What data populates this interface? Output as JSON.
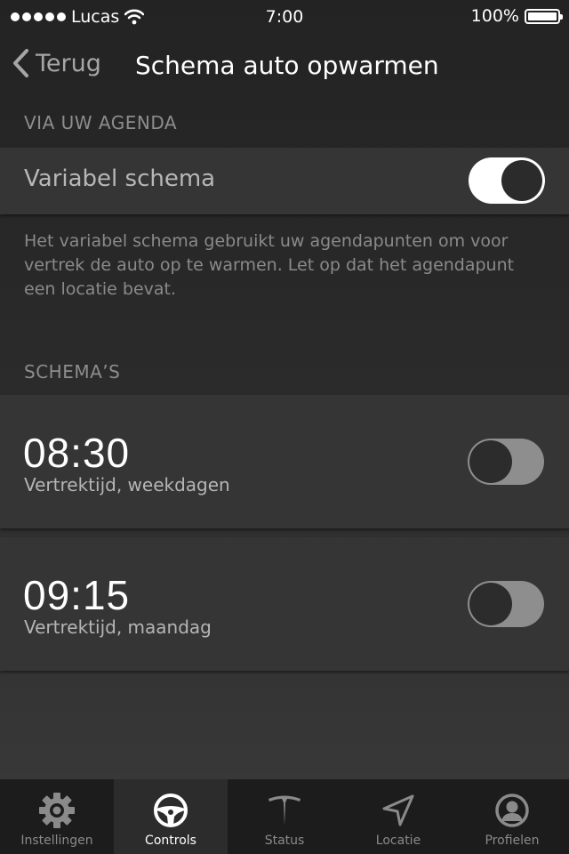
{
  "status_bar": {
    "carrier": "Lucas",
    "signal_icon": "signal-dots-icon",
    "wifi_icon": "wifi-icon",
    "time": "7:00",
    "battery_percent": "100%",
    "battery_icon": "battery-icon"
  },
  "nav": {
    "back_label": "Terug",
    "back_icon": "chevron-left-icon",
    "title": "Schema auto opwarmen"
  },
  "calendar_section": {
    "header": "VIA UW AGENDA",
    "row_label": "Variabel schema",
    "toggle_on": true,
    "description": "Het variabel schema gebruikt uw agendapunten om voor vertrek de auto op te warmen. Let op dat het agendapunt een locatie bevat."
  },
  "schedules_section": {
    "header": "SCHEMA’S",
    "items": [
      {
        "time": "08:30",
        "subtitle": "Vertrektijd, weekdagen",
        "toggle_on": false
      },
      {
        "time": "09:15",
        "subtitle": "Vertrektijd, maandag",
        "toggle_on": false
      }
    ]
  },
  "tab_bar": {
    "active": "Controls",
    "tabs": [
      {
        "label": "Instellingen",
        "icon": "gear-icon"
      },
      {
        "label": "Controls",
        "icon": "steering-wheel-icon"
      },
      {
        "label": "Status",
        "icon": "tesla-logo-icon"
      },
      {
        "label": "Locatie",
        "icon": "location-arrow-icon"
      },
      {
        "label": "Profielen",
        "icon": "profile-icon"
      }
    ]
  },
  "colors": {
    "background": "#2a2a2a",
    "row_background": "#353535",
    "tab_bar": "#1c1c1c",
    "tab_active": "#2c2c2c",
    "muted_text": "#8d8d8d"
  }
}
